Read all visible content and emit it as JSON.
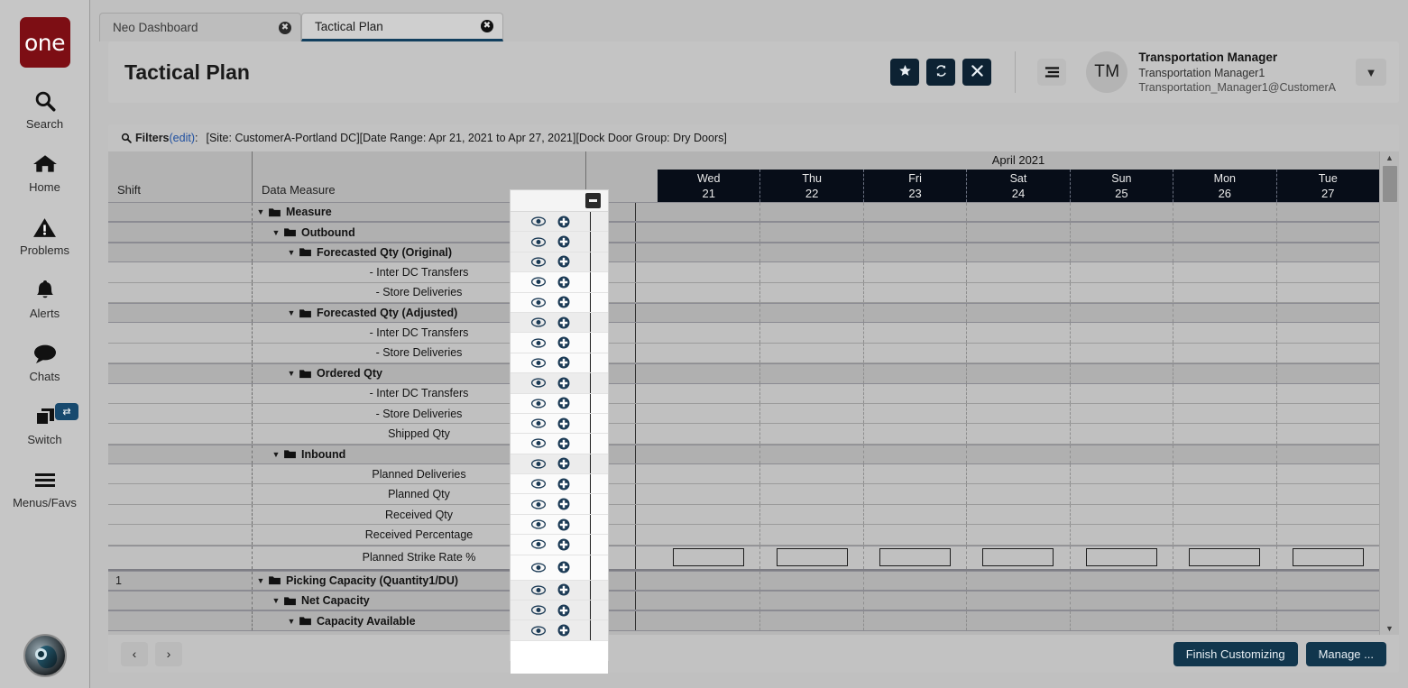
{
  "brand": {
    "logo_text": "one",
    "accent": "#7d0e14"
  },
  "rail": {
    "items": [
      {
        "label": "Search",
        "icon": "search-icon"
      },
      {
        "label": "Home",
        "icon": "home-icon"
      },
      {
        "label": "Problems",
        "icon": "warning-triangle-icon"
      },
      {
        "label": "Alerts",
        "icon": "bell-icon"
      },
      {
        "label": "Chats",
        "icon": "chat-bubble-icon"
      },
      {
        "label": "Switch",
        "icon": "windows-stack-icon",
        "badge_icon": "swap-arrows-icon"
      },
      {
        "label": "Menus/Favs",
        "icon": "hamburger-icon"
      }
    ],
    "avatar_icon": "robot-avatar-icon"
  },
  "tabs": [
    {
      "label": "Neo Dashboard",
      "active": false,
      "close_icon": "close-circle-icon"
    },
    {
      "label": "Tactical Plan",
      "active": true,
      "close_icon": "close-circle-icon"
    }
  ],
  "header": {
    "title": "Tactical Plan",
    "actions": [
      {
        "name": "favorite-button",
        "icon": "star-icon"
      },
      {
        "name": "refresh-button",
        "icon": "refresh-icon"
      },
      {
        "name": "close-button",
        "icon": "x-icon"
      }
    ],
    "menu_icon": "list-menu-icon",
    "user": {
      "initials": "TM",
      "role": "Transportation Manager",
      "name": "Transportation Manager1",
      "account": "Transportation_Manager1@CustomerA"
    },
    "caret_icon": "chevron-down-icon",
    "accent": "#0d2233"
  },
  "filters": {
    "icon": "search-icon",
    "label": "Filters",
    "edit_label": "(edit)",
    "colon": ":",
    "summary": "[Site: CustomerA-Portland DC][Date Range: Apr 21, 2021 to Apr 27, 2021][Dock Door Group: Dry Doors]"
  },
  "grid": {
    "col_shift_header": "Shift",
    "col_measure_header": "Data Measure",
    "month_band": "April 2021",
    "days": [
      {
        "dow": "Wed",
        "num": "21"
      },
      {
        "dow": "Thu",
        "num": "22"
      },
      {
        "dow": "Fri",
        "num": "23"
      },
      {
        "dow": "Sat",
        "num": "24"
      },
      {
        "dow": "Sun",
        "num": "25"
      },
      {
        "dow": "Mon",
        "num": "26"
      },
      {
        "dow": "Tue",
        "num": "27"
      }
    ],
    "rows": [
      {
        "label": "Measure",
        "type": "group",
        "indent": 0,
        "caret": "▼",
        "shift": ""
      },
      {
        "label": "Outbound",
        "type": "group",
        "indent": 1,
        "caret": "▼",
        "shift": ""
      },
      {
        "label": "Forecasted Qty (Original)",
        "type": "group",
        "indent": 2,
        "caret": "▼",
        "shift": ""
      },
      {
        "label": "- Inter DC Transfers",
        "type": "leaf",
        "indent": 3,
        "caret": "",
        "shift": ""
      },
      {
        "label": "- Store Deliveries",
        "type": "leaf",
        "indent": 3,
        "caret": "",
        "shift": ""
      },
      {
        "label": "Forecasted Qty (Adjusted)",
        "type": "group",
        "indent": 2,
        "caret": "▼",
        "shift": ""
      },
      {
        "label": "- Inter DC Transfers",
        "type": "leaf",
        "indent": 3,
        "caret": "",
        "shift": ""
      },
      {
        "label": "- Store Deliveries",
        "type": "leaf",
        "indent": 3,
        "caret": "",
        "shift": ""
      },
      {
        "label": "Ordered Qty",
        "type": "group",
        "indent": 2,
        "caret": "▼",
        "shift": ""
      },
      {
        "label": "- Inter DC Transfers",
        "type": "leaf",
        "indent": 3,
        "caret": "",
        "shift": ""
      },
      {
        "label": "- Store Deliveries",
        "type": "leaf",
        "indent": 3,
        "caret": "",
        "shift": ""
      },
      {
        "label": "Shipped Qty",
        "type": "leaf",
        "indent": 2,
        "caret": "",
        "shift": ""
      },
      {
        "label": "Inbound",
        "type": "group",
        "indent": 1,
        "caret": "▼",
        "shift": ""
      },
      {
        "label": "Planned Deliveries",
        "type": "leaf",
        "indent": 2,
        "caret": "",
        "shift": ""
      },
      {
        "label": "Planned Qty",
        "type": "leaf",
        "indent": 2,
        "caret": "",
        "shift": ""
      },
      {
        "label": "Received Qty",
        "type": "leaf",
        "indent": 2,
        "caret": "",
        "shift": ""
      },
      {
        "label": "Received Percentage",
        "type": "leaf",
        "indent": 2,
        "caret": "",
        "shift": ""
      }
    ],
    "strike_row": {
      "label": "Planned Strike Rate %",
      "input_values": [
        "",
        "",
        "",
        "",
        "",
        "",
        ""
      ]
    },
    "rows_after": [
      {
        "label": "Picking Capacity (Quantity1/DU)",
        "type": "group",
        "indent": 0,
        "caret": "▼",
        "shift": "1"
      },
      {
        "label": "Net Capacity",
        "type": "group",
        "indent": 1,
        "caret": "▼",
        "shift": ""
      },
      {
        "label": "Capacity Available",
        "type": "group",
        "indent": 2,
        "caret": "▼",
        "shift": ""
      }
    ],
    "row_action_icons": {
      "eye": "eye-icon",
      "plus": "plus-circle-icon"
    },
    "collapse_icon": "collapse-minus-icon",
    "scrollbar": {
      "up_icon": "triangle-up-icon",
      "down_icon": "triangle-down-icon"
    }
  },
  "footer": {
    "prev_label": "‹",
    "next_label": "›",
    "finish_label": "Finish Customizing",
    "manage_label": "Manage ...",
    "accent": "#11364d"
  }
}
